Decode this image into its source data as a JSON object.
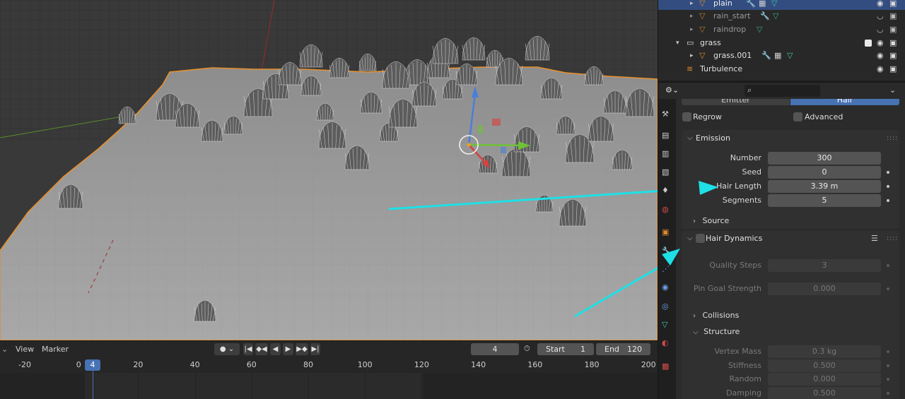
{
  "outliner": {
    "rows": [
      {
        "name": "plain",
        "selected": true
      },
      {
        "name": "rain_start",
        "selected": false
      },
      {
        "name": "raindrop",
        "selected": false
      },
      {
        "name": "grass",
        "selected": false
      },
      {
        "name": "grass.001",
        "selected": false
      },
      {
        "name": "Turbulence",
        "selected": false
      }
    ]
  },
  "properties": {
    "type_tabs": [
      "Emitter",
      "Hair"
    ],
    "regrow_label": "Regrow",
    "advanced_label": "Advanced",
    "emission": {
      "title": "Emission",
      "number_label": "Number",
      "number_value": "300",
      "seed_label": "Seed",
      "seed_value": "0",
      "hair_length_label": "Hair Length",
      "hair_length_value": "3.39 m",
      "segments_label": "Segments",
      "segments_value": "5",
      "source_label": "Source"
    },
    "hair_dynamics": {
      "title": "Hair Dynamics",
      "quality_steps_label": "Quality Steps",
      "quality_steps_value": "3",
      "pin_goal_label": "Pin Goal Strength",
      "pin_goal_value": "0.000",
      "collisions_label": "Collisions",
      "structure_label": "Structure",
      "vertex_mass_label": "Vertex Mass",
      "vertex_mass_value": "0.3 kg",
      "stiffness_label": "Stiffness",
      "stiffness_value": "0.500",
      "random_label": "Random",
      "random_value": "0.000",
      "damping_label": "Damping",
      "damping_value": "0.500"
    }
  },
  "timeline": {
    "view_label": "View",
    "marker_label": "Marker",
    "current_frame": "4",
    "start_label": "Start",
    "start_value": "1",
    "end_label": "End",
    "end_value": "120",
    "ruler": [
      "-20",
      "0",
      "20",
      "40",
      "60",
      "80",
      "100",
      "120",
      "140",
      "160",
      "180",
      "200"
    ],
    "playhead": "4"
  },
  "colors": {
    "selection": "#334d80",
    "accent": "#4772b3",
    "arrow": "#1ee0e6",
    "outline": "#e08a2e"
  }
}
